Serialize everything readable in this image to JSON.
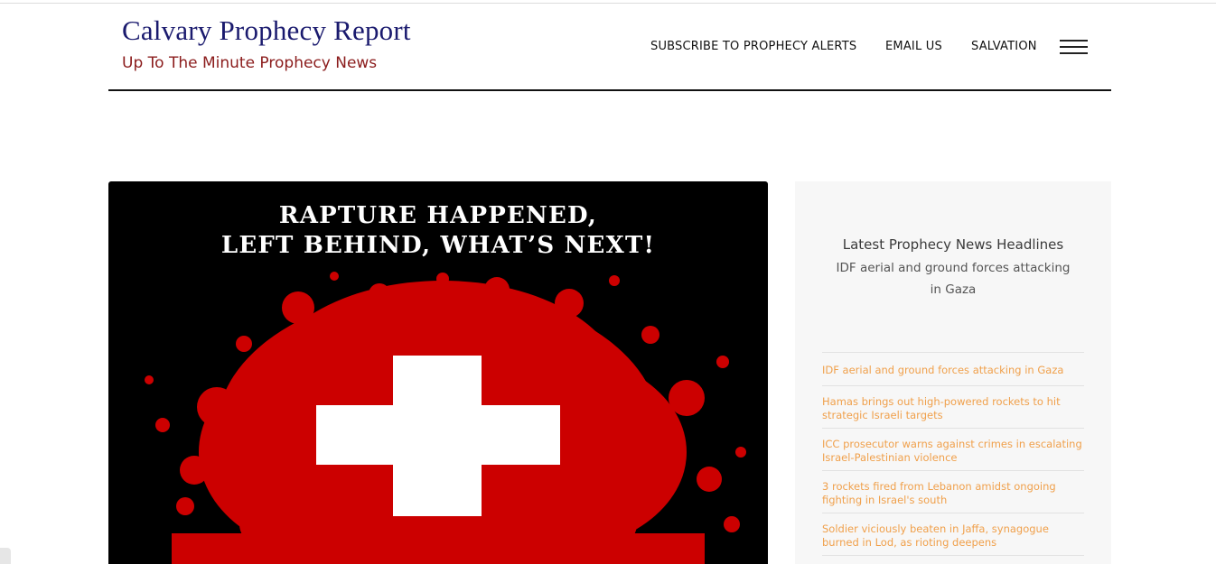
{
  "site": {
    "title": "Calvary Prophecy Report",
    "tagline": "Up To The Minute Prophecy News"
  },
  "nav": {
    "items": [
      {
        "label": "SUBSCRIBE TO PROPHECY ALERTS"
      },
      {
        "label": "EMAIL US"
      },
      {
        "label": "SALVATION"
      }
    ],
    "menu_icon": "hamburger-menu-icon"
  },
  "hero": {
    "title_line1": "RAPTURE HAPPENED,",
    "title_line2": "LEFT BEHIND, WHAT’S NEXT!",
    "image_icon": "blood-splatter-cross",
    "colors": {
      "background": "#000000",
      "splatter": "#cc0000",
      "cross": "#ffffff"
    }
  },
  "sidebar": {
    "heading": "Latest Prophecy News Headlines",
    "subheading": "IDF aerial and ground forces attacking in Gaza",
    "headlines": [
      {
        "text": "IDF aerial and ground forces attacking in Gaza"
      },
      {
        "text": "Hamas brings out high-powered rockets to hit strategic Israeli targets"
      },
      {
        "text": "ICC prosecutor warns against crimes in escalating Israel-Palestinian violence"
      },
      {
        "text": "3 rockets fired from Lebanon amidst ongoing fighting in Israel's south"
      },
      {
        "text": "Soldier viciously beaten in Jaffa, synagogue burned in Lod, as rioting deepens"
      }
    ],
    "link_color": "#f0a04b"
  }
}
